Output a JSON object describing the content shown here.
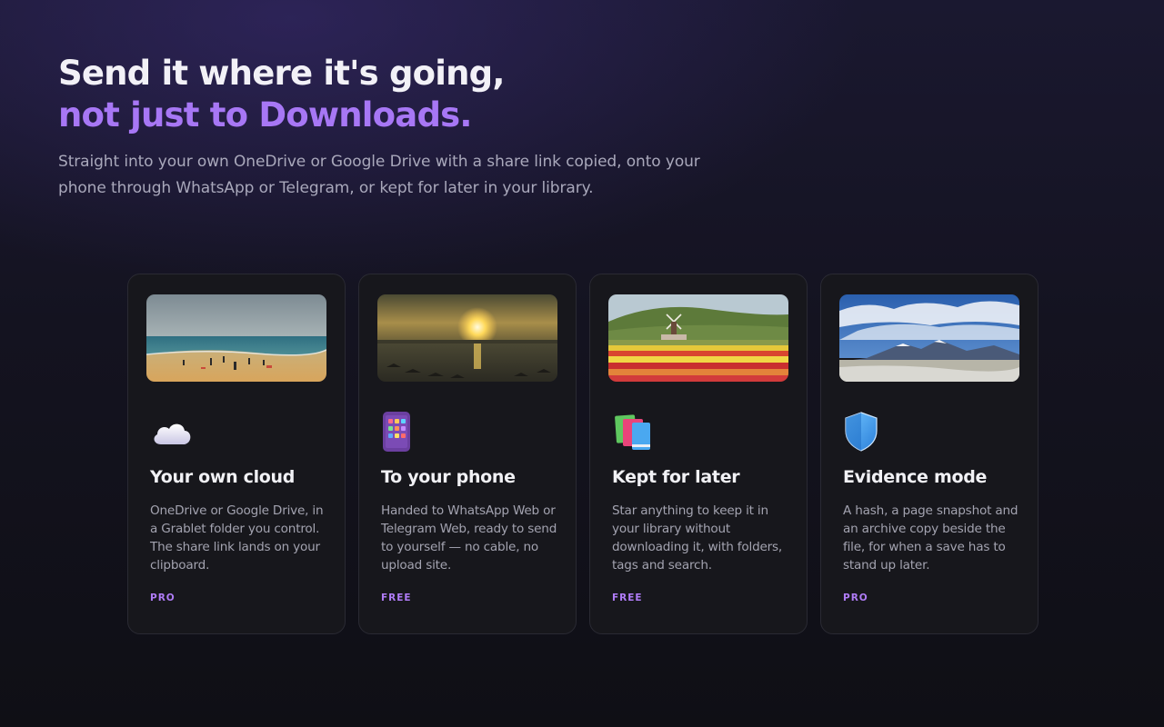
{
  "hero": {
    "title_line1": "Send it where it's going,",
    "title_line2": "not just to Downloads.",
    "subtitle": "Straight into your own OneDrive or Google Drive with a share link copied, onto your phone through WhatsApp or Telegram, or kept for later in your library."
  },
  "cards": [
    {
      "title": "Your own cloud",
      "description": "OneDrive or Google Drive, in a Grablet folder you control. The share link lands on your clipboard.",
      "tier": "PRO",
      "icon": "cloud-icon",
      "image": "beach-photo"
    },
    {
      "title": "To your phone",
      "description": "Handed to WhatsApp Web or Telegram Web, ready to send to yourself — no cable, no upload site.",
      "tier": "FREE",
      "icon": "phone-icon",
      "image": "sunset-photo"
    },
    {
      "title": "Kept for later",
      "description": "Star anything to keep it in your library without downloading it, with folders, tags and search.",
      "tier": "FREE",
      "icon": "books-icon",
      "image": "tulip-field-photo"
    },
    {
      "title": "Evidence mode",
      "description": "A hash, a page snapshot and an archive copy beside the file, for when a save has to stand up later.",
      "tier": "PRO",
      "icon": "shield-icon",
      "image": "mountain-photo"
    }
  ],
  "colors": {
    "accent": "#a777f5",
    "tier": "#b07cf7",
    "card_bg": "#17171c"
  }
}
